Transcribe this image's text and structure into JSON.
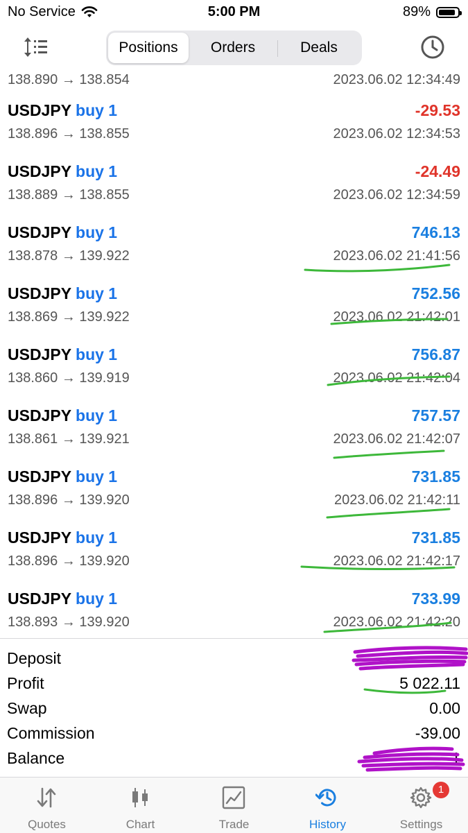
{
  "status_bar": {
    "carrier": "No Service",
    "time": "5:00 PM",
    "battery": "89%",
    "battery_level": 0.89
  },
  "header": {
    "segments": [
      {
        "label": "Positions",
        "active": true
      },
      {
        "label": "Orders",
        "active": false
      },
      {
        "label": "Deals",
        "active": false
      }
    ],
    "sort_icon": "sort-icon",
    "clock_icon": "clock-icon"
  },
  "partial_row": {
    "prices": "138.890 → 138.854",
    "time": "2023.06.02 12:34:49"
  },
  "deals": [
    {
      "symbol": "USDJPY",
      "side": "buy 1",
      "profit": "-29.53",
      "negative": true,
      "prices": "138.896 → 138.855",
      "time": "2023.06.02 12:34:53"
    },
    {
      "symbol": "USDJPY",
      "side": "buy 1",
      "profit": "-24.49",
      "negative": true,
      "prices": "138.889 → 138.855",
      "time": "2023.06.02 12:34:59"
    },
    {
      "symbol": "USDJPY",
      "side": "buy 1",
      "profit": "746.13",
      "negative": false,
      "prices": "138.878 → 139.922",
      "time": "2023.06.02 21:41:56"
    },
    {
      "symbol": "USDJPY",
      "side": "buy 1",
      "profit": "752.56",
      "negative": false,
      "prices": "138.869 → 139.922",
      "time": "2023.06.02 21:42:01"
    },
    {
      "symbol": "USDJPY",
      "side": "buy 1",
      "profit": "756.87",
      "negative": false,
      "prices": "138.860 → 139.919",
      "time": "2023.06.02 21:42:04"
    },
    {
      "symbol": "USDJPY",
      "side": "buy 1",
      "profit": "757.57",
      "negative": false,
      "prices": "138.861 → 139.921",
      "time": "2023.06.02 21:42:07"
    },
    {
      "symbol": "USDJPY",
      "side": "buy 1",
      "profit": "731.85",
      "negative": false,
      "prices": "138.896 → 139.920",
      "time": "2023.06.02 21:42:11"
    },
    {
      "symbol": "USDJPY",
      "side": "buy 1",
      "profit": "731.85",
      "negative": false,
      "prices": "138.896 → 139.920",
      "time": "2023.06.02 21:42:17"
    },
    {
      "symbol": "USDJPY",
      "side": "buy 1",
      "profit": "733.99",
      "negative": false,
      "prices": "138.893 → 139.920",
      "time": "2023.06.02 21:42:20"
    }
  ],
  "summary": {
    "deposit_label": "Deposit",
    "deposit_value": "",
    "profit_label": "Profit",
    "profit_value": "5 022.11",
    "swap_label": "Swap",
    "swap_value": "0.00",
    "commission_label": "Commission",
    "commission_value": "-39.00",
    "balance_label": "Balance",
    "balance_value": "1"
  },
  "tabs": [
    {
      "label": "Quotes",
      "icon": "quotes-arrows-icon",
      "active": false
    },
    {
      "label": "Chart",
      "icon": "candlestick-icon",
      "active": false
    },
    {
      "label": "Trade",
      "icon": "line-chart-icon",
      "active": false
    },
    {
      "label": "History",
      "icon": "history-icon",
      "active": true
    },
    {
      "label": "Settings",
      "icon": "gear-icon",
      "active": false,
      "badge": "1"
    }
  ],
  "colors": {
    "accent": "#1a7fe0",
    "negative": "#e0342a",
    "highlight_marks": "#3db83a",
    "redaction": "#b012c8"
  }
}
